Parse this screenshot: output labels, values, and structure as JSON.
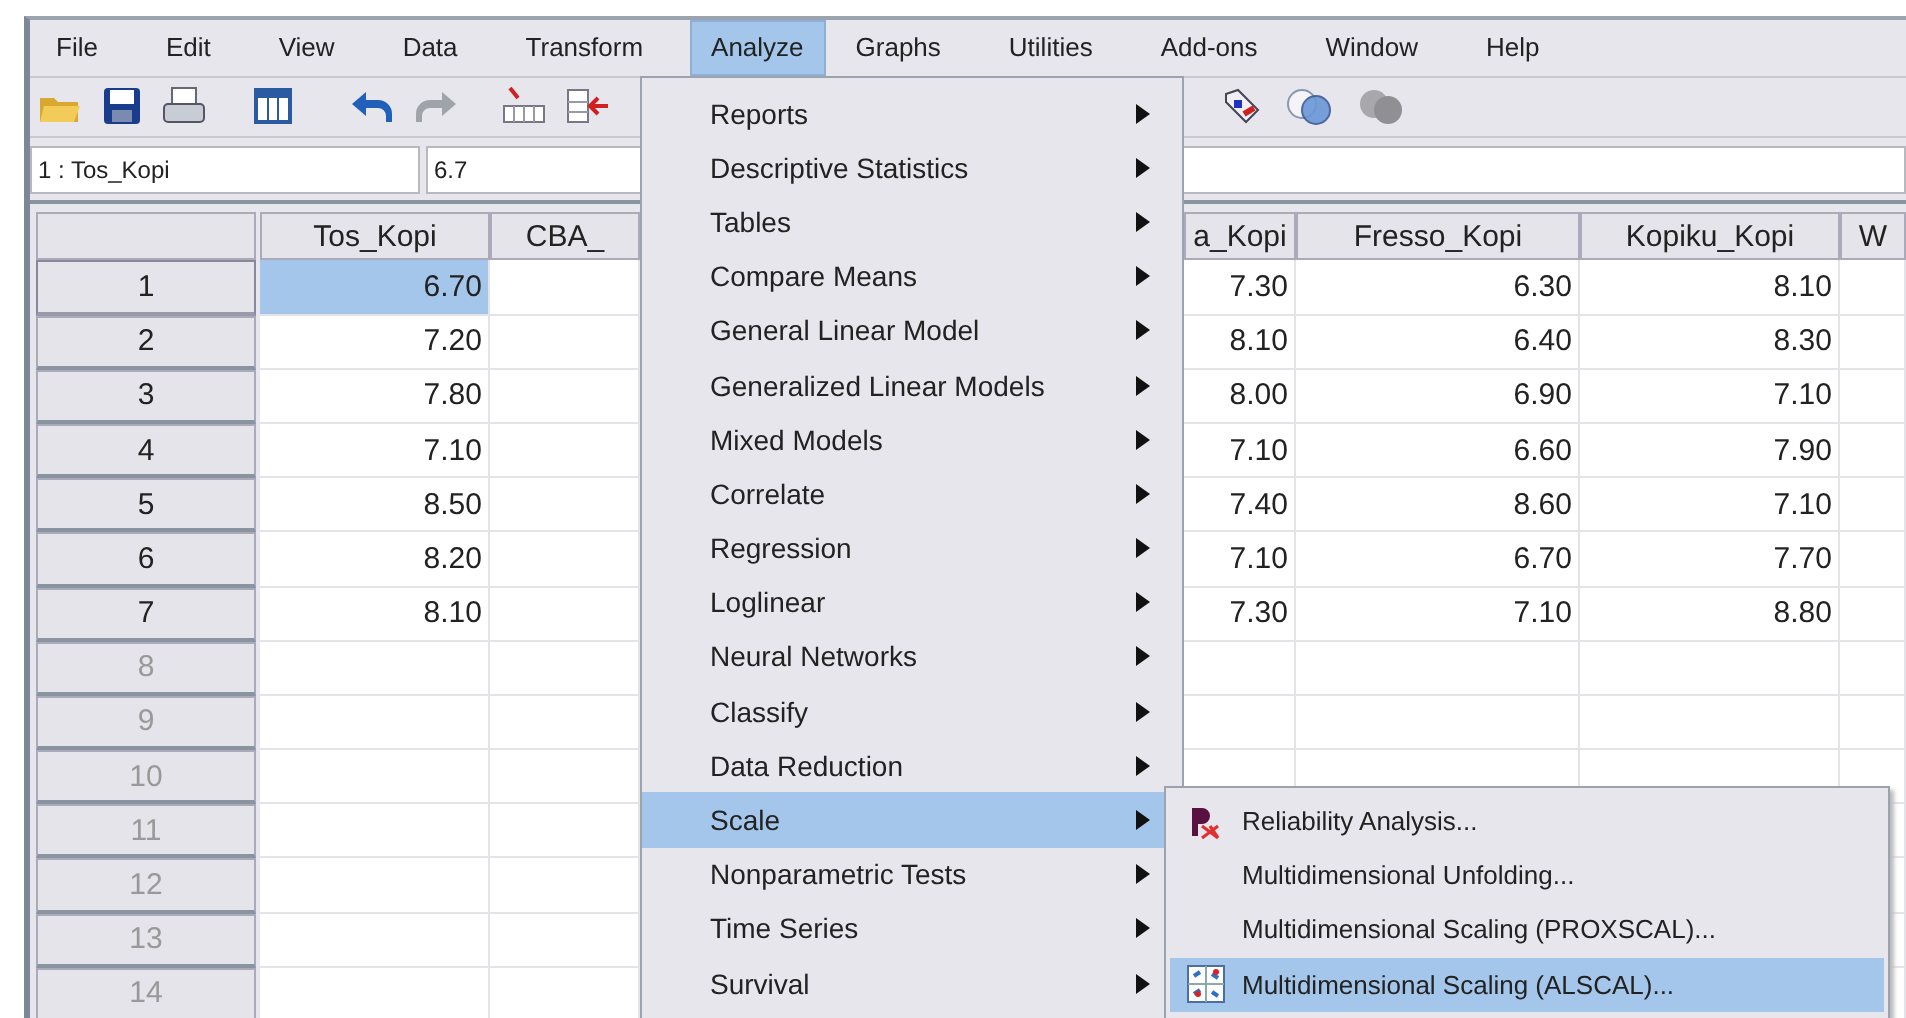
{
  "menubar": {
    "items": [
      {
        "label": "File",
        "selected": false
      },
      {
        "label": "Edit",
        "selected": false
      },
      {
        "label": "View",
        "selected": false
      },
      {
        "label": "Data",
        "selected": false
      },
      {
        "label": "Transform",
        "selected": false
      },
      {
        "label": "Analyze",
        "selected": true
      },
      {
        "label": "Graphs",
        "selected": false
      },
      {
        "label": "Utilities",
        "selected": false
      },
      {
        "label": "Add-ons",
        "selected": false
      },
      {
        "label": "Window",
        "selected": false
      },
      {
        "label": "Help",
        "selected": false
      }
    ]
  },
  "cell_editor": {
    "cell": "1 : Tos_Kopi",
    "value": "6.7"
  },
  "table": {
    "columns": [
      {
        "label": "Tos_Kopi",
        "kind": "data"
      },
      {
        "label": "CBA_",
        "kind": "empty"
      },
      {
        "label": "a_Kopi",
        "kind": "data"
      },
      {
        "label": "Fresso_Kopi",
        "kind": "data"
      },
      {
        "label": "Kopiku_Kopi",
        "kind": "data"
      },
      {
        "label": "W",
        "kind": "empty"
      }
    ],
    "rows": [
      {
        "number": "1",
        "selected": true,
        "greyed": false,
        "values": [
          "6.70",
          "7.30",
          "6.30",
          "8.10"
        ]
      },
      {
        "number": "2",
        "selected": false,
        "greyed": false,
        "values": [
          "7.20",
          "8.10",
          "6.40",
          "8.30"
        ]
      },
      {
        "number": "3",
        "selected": false,
        "greyed": false,
        "values": [
          "7.80",
          "8.00",
          "6.90",
          "7.10"
        ]
      },
      {
        "number": "4",
        "selected": false,
        "greyed": false,
        "values": [
          "7.10",
          "7.10",
          "6.60",
          "7.90"
        ]
      },
      {
        "number": "5",
        "selected": false,
        "greyed": false,
        "values": [
          "8.50",
          "7.40",
          "8.60",
          "7.10"
        ]
      },
      {
        "number": "6",
        "selected": false,
        "greyed": false,
        "values": [
          "8.20",
          "7.10",
          "6.70",
          "7.70"
        ]
      },
      {
        "number": "7",
        "selected": false,
        "greyed": false,
        "values": [
          "8.10",
          "7.30",
          "7.10",
          "8.80"
        ]
      },
      {
        "number": "8",
        "selected": false,
        "greyed": true
      },
      {
        "number": "9",
        "selected": false,
        "greyed": true
      },
      {
        "number": "10",
        "selected": false,
        "greyed": true
      },
      {
        "number": "11",
        "selected": false,
        "greyed": true
      },
      {
        "number": "12",
        "selected": false,
        "greyed": true
      },
      {
        "number": "13",
        "selected": false,
        "greyed": true
      },
      {
        "number": "14",
        "selected": false,
        "greyed": true
      }
    ]
  },
  "menu": {
    "items": [
      {
        "label": "Reports",
        "selected": false
      },
      {
        "label": "Descriptive Statistics",
        "selected": false
      },
      {
        "label": "Tables",
        "selected": false
      },
      {
        "label": "Compare Means",
        "selected": false
      },
      {
        "label": "General Linear Model",
        "selected": false
      },
      {
        "label": "Generalized Linear Models",
        "selected": false
      },
      {
        "label": "Mixed Models",
        "selected": false
      },
      {
        "label": "Correlate",
        "selected": false
      },
      {
        "label": "Regression",
        "selected": false
      },
      {
        "label": "Loglinear",
        "selected": false
      },
      {
        "label": "Neural Networks",
        "selected": false
      },
      {
        "label": "Classify",
        "selected": false
      },
      {
        "label": "Data Reduction",
        "selected": false
      },
      {
        "label": "Scale",
        "selected": true
      },
      {
        "label": "Nonparametric Tests",
        "selected": false
      },
      {
        "label": "Time Series",
        "selected": false
      },
      {
        "label": "Survival",
        "selected": false
      }
    ]
  },
  "submenu": {
    "items": [
      {
        "label": "Reliability Analysis...",
        "selected": false
      },
      {
        "label": "Multidimensional Unfolding...",
        "selected": false
      },
      {
        "label": "Multidimensional Scaling (PROXSCAL)...",
        "selected": false
      },
      {
        "label": "Multidimensional Scaling (ALSCAL)...",
        "selected": true
      }
    ]
  }
}
